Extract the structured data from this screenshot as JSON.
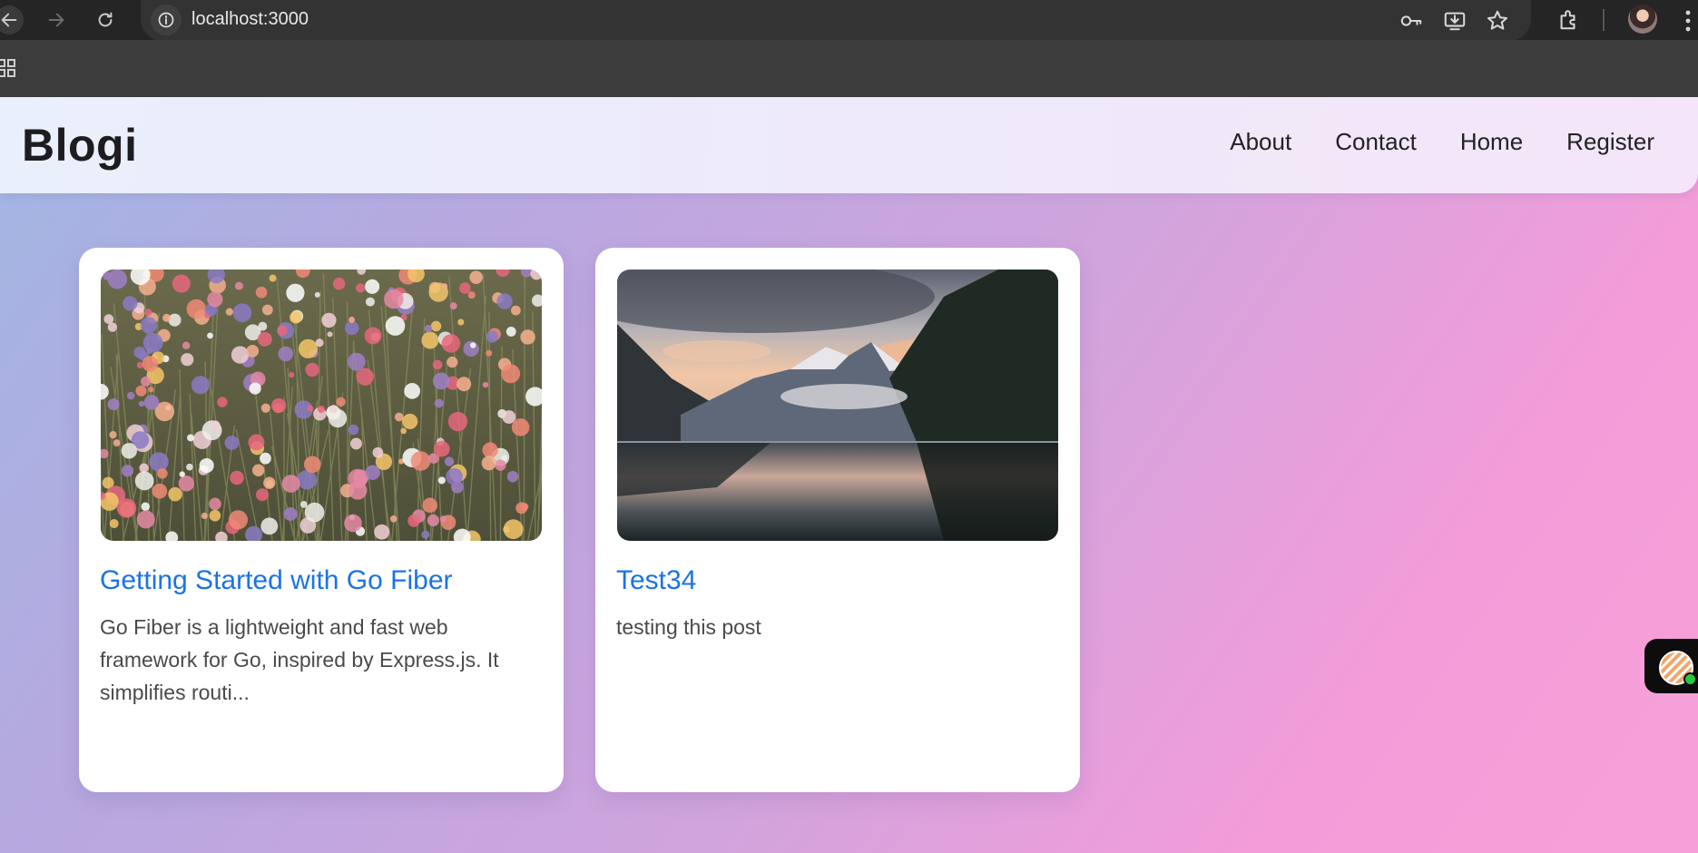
{
  "browser": {
    "url": "localhost:3000",
    "colors": {
      "toolbar": "#252525",
      "omnibox": "#333333",
      "bookmarks_bar": "#3c3c3c"
    },
    "icons": [
      "back-arrow-icon",
      "forward-arrow-icon",
      "reload-icon",
      "site-info-icon",
      "key-icon",
      "install-app-icon",
      "star-icon",
      "extensions-icon",
      "profile-avatar",
      "more-menu-icon",
      "apps-grid-icon"
    ]
  },
  "site": {
    "brand": "Blogi",
    "nav": [
      {
        "label": "About"
      },
      {
        "label": "Contact"
      },
      {
        "label": "Home"
      },
      {
        "label": "Register"
      }
    ]
  },
  "posts": [
    {
      "title": "Getting Started with Go Fiber",
      "excerpt": "Go Fiber is a lightweight and fast web framework for Go, inspired by Express.js. It simplifies routi...",
      "image": "wildflower-field-photo"
    },
    {
      "title": "Test34",
      "excerpt": "testing this post",
      "image": "mountain-lake-sunset-photo"
    }
  ],
  "theme": {
    "link_color": "#1a73e8",
    "gradient_start": "#a1b7e3",
    "gradient_end": "#f7a0d8"
  },
  "chat_widget": {
    "status": "online",
    "status_color": "#28c840"
  }
}
